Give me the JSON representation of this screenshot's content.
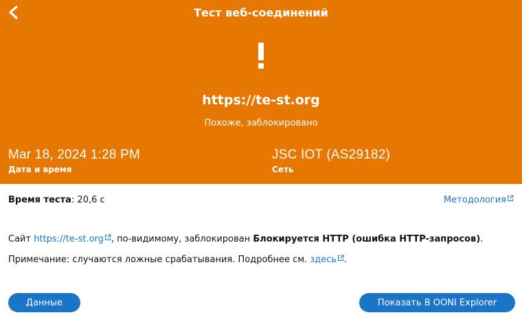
{
  "header": {
    "title": "Тест веб-соединений",
    "url": "https://te-st.org",
    "status": "Похоже, заблокировано",
    "date_value": "Mar 18, 2024 1:28 PM",
    "date_label": "Дата и время",
    "network_value": "JSC IOT (AS29182)",
    "network_label": "Сеть",
    "color": "#e67700"
  },
  "details": {
    "runtime_label": "Время теста",
    "runtime_value": ": 20,6 с",
    "methodology_link": "Методология",
    "summary": {
      "prefix": "Сайт ",
      "link": "https://te-st.org",
      "middle": ", по-видимому, заблокирован ",
      "reason": "Блокируется HTTP (ошибка HTTP-запросов)",
      "suffix": "."
    },
    "note": {
      "text": "Примечание: случаются ложные срабатывания. Подробнее см. ",
      "link": "здесь",
      "suffix": "."
    }
  },
  "buttons": {
    "data_label": "Данные",
    "explorer_label": "Показать В OONI Explorer",
    "color": "#1a75c9"
  }
}
